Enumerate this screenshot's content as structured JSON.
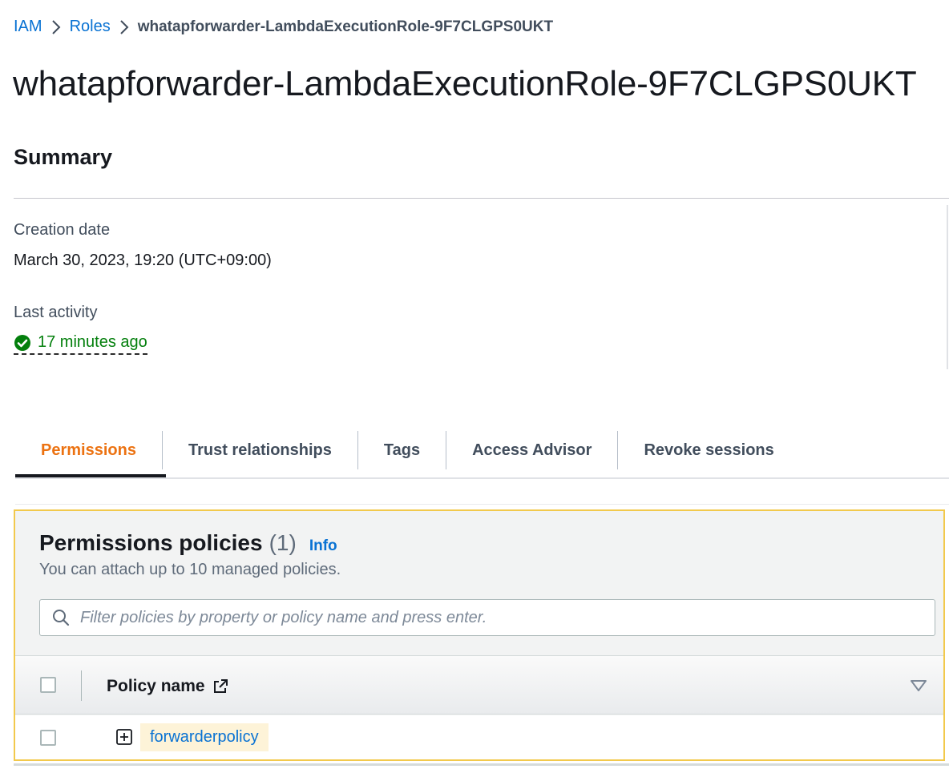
{
  "breadcrumb": {
    "items": [
      "IAM",
      "Roles"
    ],
    "current": "whatapforwarder-LambdaExecutionRole-9F7CLGPS0UKT"
  },
  "page": {
    "title": "whatapforwarder-LambdaExecutionRole-9F7CLGPS0UKT"
  },
  "summary": {
    "title": "Summary",
    "creation_label": "Creation date",
    "creation_value": "March 30, 2023, 19:20 (UTC+09:00)",
    "activity_label": "Last activity",
    "activity_value": "17 minutes ago"
  },
  "tabs": [
    "Permissions",
    "Trust relationships",
    "Tags",
    "Access Advisor",
    "Revoke sessions"
  ],
  "permissions": {
    "title": "Permissions policies",
    "count": "(1)",
    "info": "Info",
    "subtitle": "You can attach up to 10 managed policies.",
    "search_placeholder": "Filter policies by property or policy name and press enter.",
    "column_policy_name": "Policy name",
    "rows": [
      {
        "name": "forwarderpolicy"
      }
    ]
  },
  "colors": {
    "link": "#0972d3",
    "active_tab": "#ec7211",
    "success": "#037f0c",
    "highlight_border": "#f2c94c"
  },
  "icons": [
    "chevron-right-icon",
    "check-circle-icon",
    "search-icon",
    "external-link-icon",
    "caret-down-icon",
    "expand-plus-icon"
  ]
}
